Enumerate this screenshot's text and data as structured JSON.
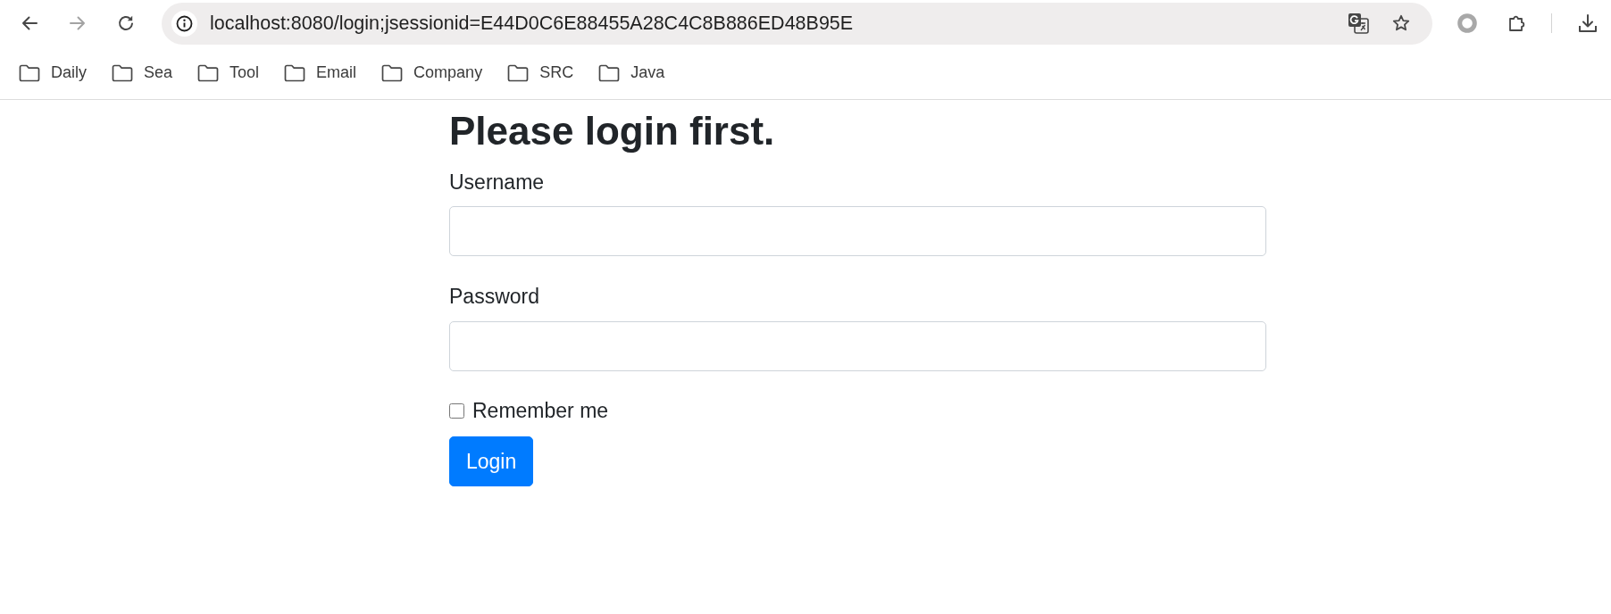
{
  "browser": {
    "nav_buttons": [
      {
        "kind": "back",
        "disabled": false
      },
      {
        "kind": "forward",
        "disabled": true
      },
      {
        "kind": "reload",
        "disabled": false
      }
    ],
    "address_bar": {
      "url": "localhost:8080/login;jsessionid=E44D0C6E88455A28C4C8B886ED48B95E"
    },
    "bookmarks": [
      {
        "label": "Daily"
      },
      {
        "label": "Sea"
      },
      {
        "label": "Tool"
      },
      {
        "label": "Email"
      },
      {
        "label": "Company"
      },
      {
        "label": "SRC"
      },
      {
        "label": "Java"
      }
    ]
  },
  "page": {
    "heading": "Please login first.",
    "fields": [
      {
        "label": "Username"
      },
      {
        "label": "Password"
      }
    ],
    "remember": {
      "label": "Remember me",
      "checked": false
    },
    "button": {
      "label": "Login"
    }
  }
}
